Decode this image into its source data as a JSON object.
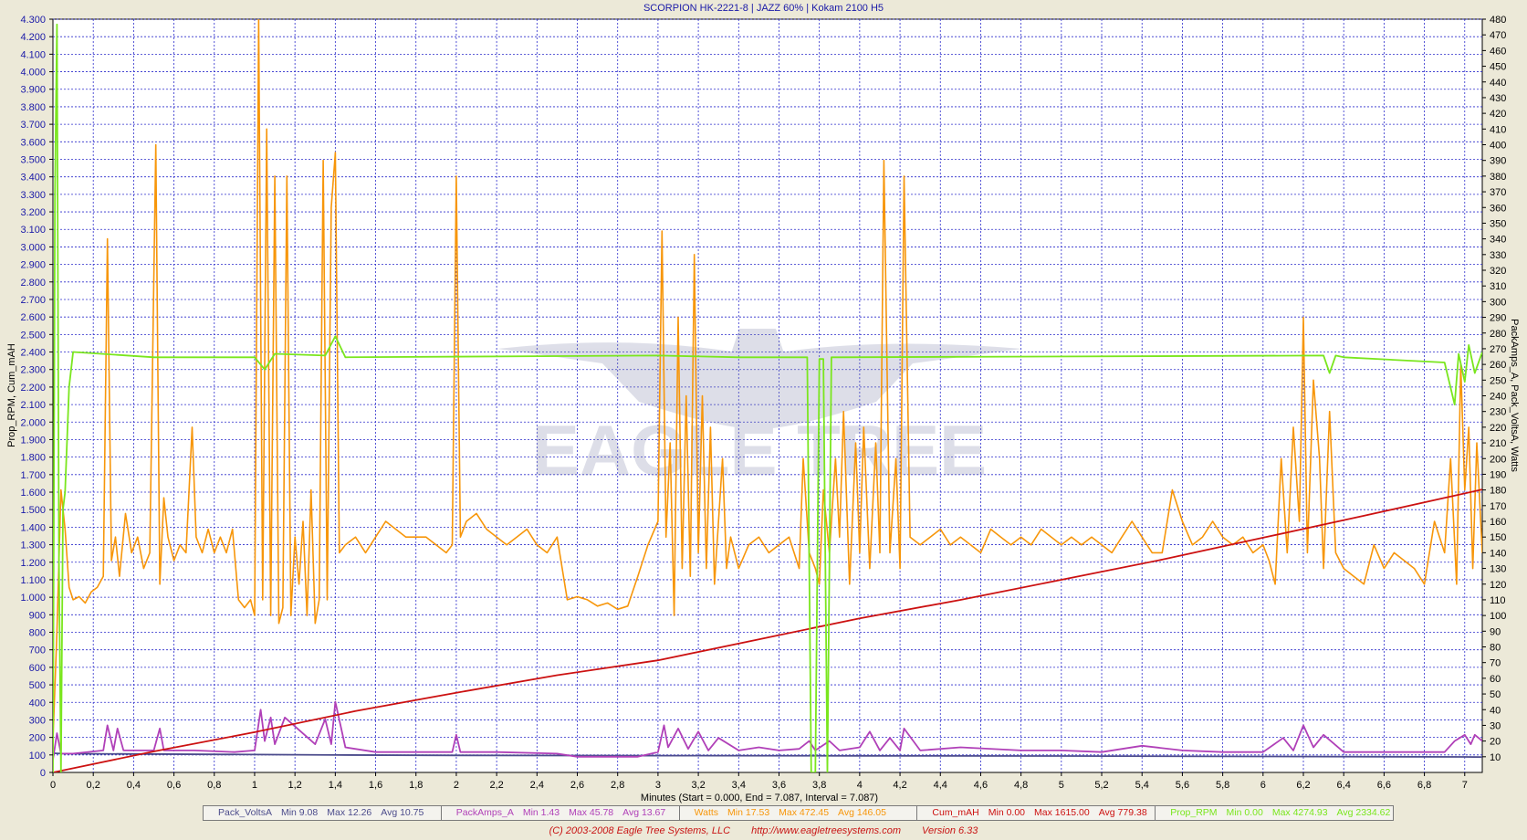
{
  "chart_data": {
    "type": "line",
    "title": "SCORPION HK-2221-8 | JAZZ 60% | Kokam 2100 H5",
    "xlabel": "Minutes (Start = 0.000,  End = 7.087,  Interval =  7.087)",
    "ylabel_left": "Prop_RPM, Cum_mAH",
    "ylabel_right": "PackAmps_A, Pack_VoltsA, Watts",
    "xlim": [
      0,
      7.087
    ],
    "ylim_left": [
      0,
      4300
    ],
    "ylim_right": [
      0,
      480
    ],
    "grid": true,
    "x_ticks": [
      "0",
      "0,2",
      "0,4",
      "0,6",
      "0,8",
      "1",
      "1,2",
      "1,4",
      "1,6",
      "1,8",
      "2",
      "2,2",
      "2,4",
      "2,6",
      "2,8",
      "3",
      "3,2",
      "3,4",
      "3,6",
      "3,8",
      "4",
      "4,2",
      "4,4",
      "4,6",
      "4,8",
      "5",
      "5,2",
      "5,4",
      "5,6",
      "5,8",
      "6",
      "6,2",
      "6,4",
      "6,6",
      "6,8",
      "7"
    ],
    "y_ticks_left": [
      "0",
      "100",
      "200",
      "300",
      "400",
      "500",
      "600",
      "700",
      "800",
      "900",
      "1.000",
      "1.100",
      "1.200",
      "1.300",
      "1.400",
      "1.500",
      "1.600",
      "1.700",
      "1.800",
      "1.900",
      "2.000",
      "2.100",
      "2.200",
      "2.300",
      "2.400",
      "2.500",
      "2.600",
      "2.700",
      "2.800",
      "2.900",
      "3.000",
      "3.100",
      "3.200",
      "3.300",
      "3.400",
      "3.500",
      "3.600",
      "3.700",
      "3.800",
      "3.900",
      "4.000",
      "4.100",
      "4.200",
      "4.300"
    ],
    "y_ticks_right": [
      "10",
      "20",
      "30",
      "40",
      "50",
      "60",
      "70",
      "80",
      "90",
      "100",
      "110",
      "120",
      "130",
      "140",
      "150",
      "160",
      "170",
      "180",
      "190",
      "200",
      "210",
      "220",
      "230",
      "240",
      "250",
      "260",
      "270",
      "280",
      "290",
      "300",
      "310",
      "320",
      "330",
      "340",
      "350",
      "360",
      "370",
      "380",
      "390",
      "400",
      "410",
      "420",
      "430",
      "440",
      "450",
      "460",
      "470",
      "480"
    ],
    "series": [
      {
        "name": "Pack_VoltsA",
        "axis": "right",
        "color": "#4c4c8c",
        "stats": {
          "min": "Min 9.08",
          "max": "Max 12.26",
          "avg": "Avg 10.75"
        },
        "x": [
          0,
          0.05,
          0.1,
          1.0,
          1.4,
          2.0,
          3.0,
          4.0,
          5.0,
          6.0,
          7.0,
          7.087
        ],
        "y": [
          12.2,
          12.0,
          11.9,
          11.4,
          11.1,
          10.9,
          10.7,
          10.6,
          10.5,
          10.2,
          9.9,
          9.8
        ]
      },
      {
        "name": "PackAmps_A",
        "axis": "right",
        "color": "#b040b8",
        "stats": {
          "min": "Min 1.43",
          "max": "Max 45.78",
          "avg": "Avg 13.67"
        },
        "x": [
          0,
          0.02,
          0.04,
          0.1,
          0.25,
          0.27,
          0.3,
          0.32,
          0.35,
          0.5,
          0.53,
          0.55,
          0.7,
          0.9,
          1.0,
          1.03,
          1.05,
          1.08,
          1.1,
          1.15,
          1.3,
          1.35,
          1.38,
          1.4,
          1.45,
          1.6,
          1.8,
          1.98,
          2.0,
          2.02,
          2.2,
          2.5,
          2.6,
          2.8,
          2.9,
          3.0,
          3.03,
          3.05,
          3.1,
          3.15,
          3.2,
          3.25,
          3.3,
          3.4,
          3.5,
          3.6,
          3.7,
          3.75,
          3.78,
          3.85,
          3.9,
          4.0,
          4.05,
          4.1,
          4.15,
          4.2,
          4.22,
          4.3,
          4.5,
          4.8,
          5.0,
          5.2,
          5.4,
          5.6,
          5.8,
          5.95,
          6.0,
          6.1,
          6.15,
          6.2,
          6.25,
          6.3,
          6.4,
          6.6,
          6.8,
          6.9,
          6.95,
          7.0,
          7.03,
          7.05,
          7.087
        ],
        "y": [
          8,
          25,
          12,
          12,
          14,
          30,
          14,
          28,
          14,
          14,
          28,
          14,
          14,
          13,
          14,
          40,
          20,
          35,
          18,
          35,
          18,
          34,
          18,
          45,
          16,
          13,
          13,
          13,
          24,
          13,
          13,
          12,
          10,
          10,
          10,
          13,
          30,
          16,
          28,
          15,
          26,
          14,
          22,
          14,
          16,
          14,
          15,
          20,
          14,
          20,
          14,
          16,
          26,
          14,
          22,
          14,
          28,
          14,
          16,
          14,
          14,
          13,
          17,
          14,
          13,
          13,
          13,
          22,
          14,
          30,
          16,
          24,
          13,
          13,
          13,
          13,
          20,
          24,
          18,
          24,
          20
        ]
      },
      {
        "name": "Watts",
        "axis": "right",
        "color": "#f7960a",
        "stats": {
          "min": "Min 17.53",
          "max": "Max 472.45",
          "avg": "Avg 146.05"
        },
        "x": [
          0,
          0.02,
          0.04,
          0.06,
          0.08,
          0.1,
          0.13,
          0.16,
          0.19,
          0.22,
          0.25,
          0.27,
          0.29,
          0.31,
          0.33,
          0.36,
          0.39,
          0.42,
          0.45,
          0.48,
          0.51,
          0.53,
          0.55,
          0.57,
          0.6,
          0.63,
          0.66,
          0.69,
          0.71,
          0.74,
          0.77,
          0.8,
          0.83,
          0.86,
          0.89,
          0.92,
          0.95,
          0.98,
          1.0,
          1.02,
          1.04,
          1.06,
          1.08,
          1.1,
          1.12,
          1.14,
          1.16,
          1.18,
          1.2,
          1.22,
          1.24,
          1.26,
          1.28,
          1.3,
          1.32,
          1.34,
          1.36,
          1.38,
          1.4,
          1.42,
          1.45,
          1.5,
          1.55,
          1.6,
          1.65,
          1.7,
          1.75,
          1.8,
          1.85,
          1.9,
          1.95,
          1.98,
          2.0,
          2.02,
          2.05,
          2.1,
          2.15,
          2.2,
          2.25,
          2.3,
          2.35,
          2.4,
          2.45,
          2.5,
          2.55,
          2.6,
          2.65,
          2.7,
          2.75,
          2.8,
          2.85,
          2.9,
          2.95,
          3.0,
          3.02,
          3.04,
          3.06,
          3.08,
          3.1,
          3.12,
          3.14,
          3.16,
          3.18,
          3.2,
          3.22,
          3.24,
          3.26,
          3.28,
          3.3,
          3.32,
          3.34,
          3.36,
          3.38,
          3.4,
          3.45,
          3.5,
          3.55,
          3.6,
          3.65,
          3.7,
          3.72,
          3.75,
          3.78,
          3.8,
          3.82,
          3.85,
          3.88,
          3.9,
          3.92,
          3.95,
          3.98,
          4.0,
          4.02,
          4.05,
          4.08,
          4.1,
          4.12,
          4.15,
          4.18,
          4.2,
          4.22,
          4.25,
          4.3,
          4.35,
          4.4,
          4.45,
          4.5,
          4.55,
          4.6,
          4.65,
          4.7,
          4.75,
          4.8,
          4.85,
          4.9,
          4.95,
          5.0,
          5.05,
          5.1,
          5.15,
          5.2,
          5.25,
          5.3,
          5.35,
          5.4,
          5.45,
          5.5,
          5.55,
          5.6,
          5.65,
          5.7,
          5.75,
          5.8,
          5.85,
          5.9,
          5.95,
          6.0,
          6.03,
          6.06,
          6.09,
          6.12,
          6.15,
          6.18,
          6.2,
          6.22,
          6.25,
          6.28,
          6.3,
          6.33,
          6.36,
          6.4,
          6.45,
          6.5,
          6.55,
          6.6,
          6.65,
          6.7,
          6.75,
          6.8,
          6.85,
          6.9,
          6.93,
          6.96,
          6.98,
          7.0,
          7.02,
          7.04,
          7.06,
          7.087
        ],
        "y": [
          20,
          90,
          180,
          155,
          118,
          110,
          112,
          108,
          115,
          118,
          125,
          340,
          135,
          150,
          125,
          165,
          140,
          150,
          130,
          140,
          400,
          120,
          175,
          150,
          135,
          145,
          140,
          220,
          150,
          140,
          155,
          140,
          150,
          140,
          155,
          110,
          105,
          110,
          100,
          480,
          110,
          410,
          100,
          380,
          95,
          105,
          380,
          100,
          150,
          120,
          160,
          100,
          180,
          95,
          110,
          390,
          110,
          360,
          395,
          140,
          145,
          150,
          140,
          150,
          160,
          155,
          150,
          150,
          150,
          145,
          140,
          145,
          380,
          150,
          160,
          165,
          155,
          150,
          145,
          150,
          155,
          145,
          140,
          150,
          110,
          112,
          110,
          106,
          108,
          104,
          106,
          125,
          145,
          160,
          345,
          150,
          210,
          100,
          290,
          130,
          240,
          125,
          330,
          140,
          240,
          130,
          220,
          120,
          160,
          200,
          130,
          150,
          140,
          130,
          145,
          150,
          140,
          145,
          150,
          130,
          200,
          140,
          130,
          120,
          180,
          140,
          200,
          150,
          230,
          120,
          210,
          140,
          220,
          130,
          210,
          140,
          390,
          140,
          200,
          130,
          380,
          150,
          145,
          150,
          155,
          145,
          150,
          145,
          140,
          155,
          150,
          145,
          150,
          145,
          155,
          150,
          145,
          150,
          145,
          150,
          145,
          140,
          150,
          160,
          150,
          140,
          140,
          180,
          160,
          145,
          150,
          160,
          150,
          145,
          150,
          140,
          145,
          135,
          120,
          200,
          140,
          220,
          160,
          290,
          140,
          250,
          200,
          130,
          230,
          140,
          130,
          125,
          120,
          145,
          130,
          140,
          135,
          130,
          120,
          160,
          140,
          200,
          120,
          260,
          180,
          220,
          130,
          210,
          140
        ]
      },
      {
        "name": "Cum_mAH",
        "axis": "left",
        "color": "#cc1111",
        "stats": {
          "min": "Min 0.00",
          "max": "Max 1615.00",
          "avg": "Avg 779.38"
        },
        "x": [
          0,
          0.5,
          1.0,
          1.5,
          2.0,
          2.5,
          3.0,
          3.5,
          4.0,
          4.5,
          5.0,
          5.5,
          6.0,
          6.5,
          7.087
        ],
        "y": [
          0,
          120,
          230,
          350,
          455,
          555,
          640,
          760,
          880,
          985,
          1100,
          1215,
          1340,
          1465,
          1615
        ]
      },
      {
        "name": "Prop_RPM",
        "axis": "left",
        "color": "#7ae61e",
        "stats": {
          "min": "Min 0.00",
          "max": "Max 4274.93",
          "avg": "Avg 2334.62"
        },
        "x": [
          0,
          0.01,
          0.02,
          0.03,
          0.04,
          0.05,
          0.06,
          0.07,
          0.08,
          0.1,
          0.5,
          1.0,
          1.05,
          1.1,
          1.35,
          1.4,
          1.45,
          3.0,
          3.4,
          3.74,
          3.76,
          3.78,
          3.8,
          3.82,
          3.84,
          3.86,
          3.9,
          6.3,
          6.33,
          6.36,
          6.4,
          6.9,
          6.95,
          6.97,
          7.0,
          7.02,
          7.05,
          7.087
        ],
        "y": [
          0,
          3300,
          4270,
          1200,
          0,
          1500,
          1600,
          1900,
          2200,
          2400,
          2370,
          2370,
          2300,
          2390,
          2380,
          2490,
          2370,
          2380,
          2370,
          2370,
          0,
          0,
          2360,
          2360,
          0,
          2370,
          2370,
          2380,
          2280,
          2380,
          2370,
          2340,
          2100,
          2390,
          2230,
          2440,
          2280,
          2400
        ]
      }
    ],
    "watermark": "EAGLE TREE"
  },
  "footer": {
    "copyright": "(C) 2003-2008 Eagle Tree Systems, LLC",
    "url": "http://www.eagletreesystems.com",
    "version": "Version 6.33"
  }
}
